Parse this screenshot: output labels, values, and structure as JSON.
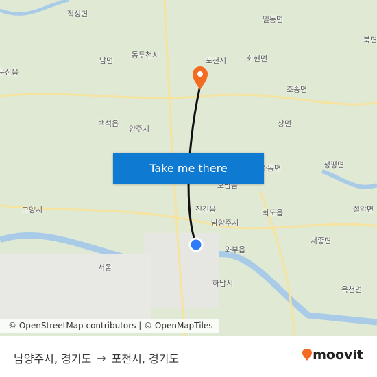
{
  "map": {
    "labels": [
      "적성면",
      "일동면",
      "북면",
      "남면",
      "동두천시",
      "포천시",
      "화현면",
      "문산읍",
      "조종면",
      "백석읍",
      "양주시",
      "상면",
      "청평면",
      "수동면",
      "오남읍",
      "고양시",
      "진건읍",
      "화도읍",
      "남양주시",
      "설악면",
      "서종면",
      "와부읍",
      "서울",
      "하남시",
      "옥천면"
    ],
    "attribution": "© OpenStreetMap contributors | © OpenMapTiles",
    "origin_color": "#2f7cf6",
    "destination_color": "#f36c21"
  },
  "cta": {
    "label": "Take me there"
  },
  "footer": {
    "origin": "남양주시, 경기도",
    "arrow": "→",
    "destination": "포천시, 경기도",
    "brand": "moovit"
  }
}
